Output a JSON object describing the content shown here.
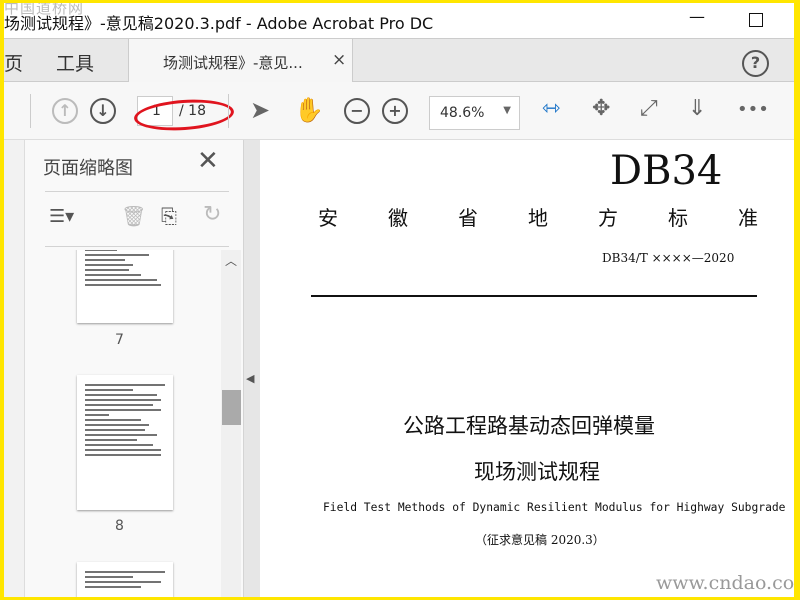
{
  "watermark_top": "中国道桥网",
  "window": {
    "title": "场测试规程》-意见稿2020.3.pdf - Adobe Acrobat Pro DC",
    "minimize": "—",
    "maximize": "☐"
  },
  "tabs": {
    "home": "页",
    "tools": "工具",
    "document": "场测试规程》-意见...",
    "close": "×"
  },
  "toolbar": {
    "page_current": "1",
    "page_total": "/ 18",
    "zoom": "48.6%"
  },
  "thumbnail_panel": {
    "title": "页面缩略图",
    "pages": [
      {
        "number": "7"
      },
      {
        "number": "8"
      }
    ]
  },
  "document": {
    "code": "DB34",
    "org": [
      "安",
      "徽",
      "省",
      "地",
      "方",
      "标",
      "准"
    ],
    "std_number": "DB34/T ××××—2020",
    "title_line1": "公路工程路基动态回弹模量",
    "title_line2": "现场测试规程",
    "title_en": "Field Test Methods of Dynamic Resilient Modulus for Highway Subgrade",
    "draft_note": "（征求意见稿 2020.3）"
  },
  "watermark_bottom": "www.cndao.com",
  "colors": {
    "accent": "#1a73c8",
    "annotation": "#e0141e",
    "frame": "#ffe600"
  }
}
